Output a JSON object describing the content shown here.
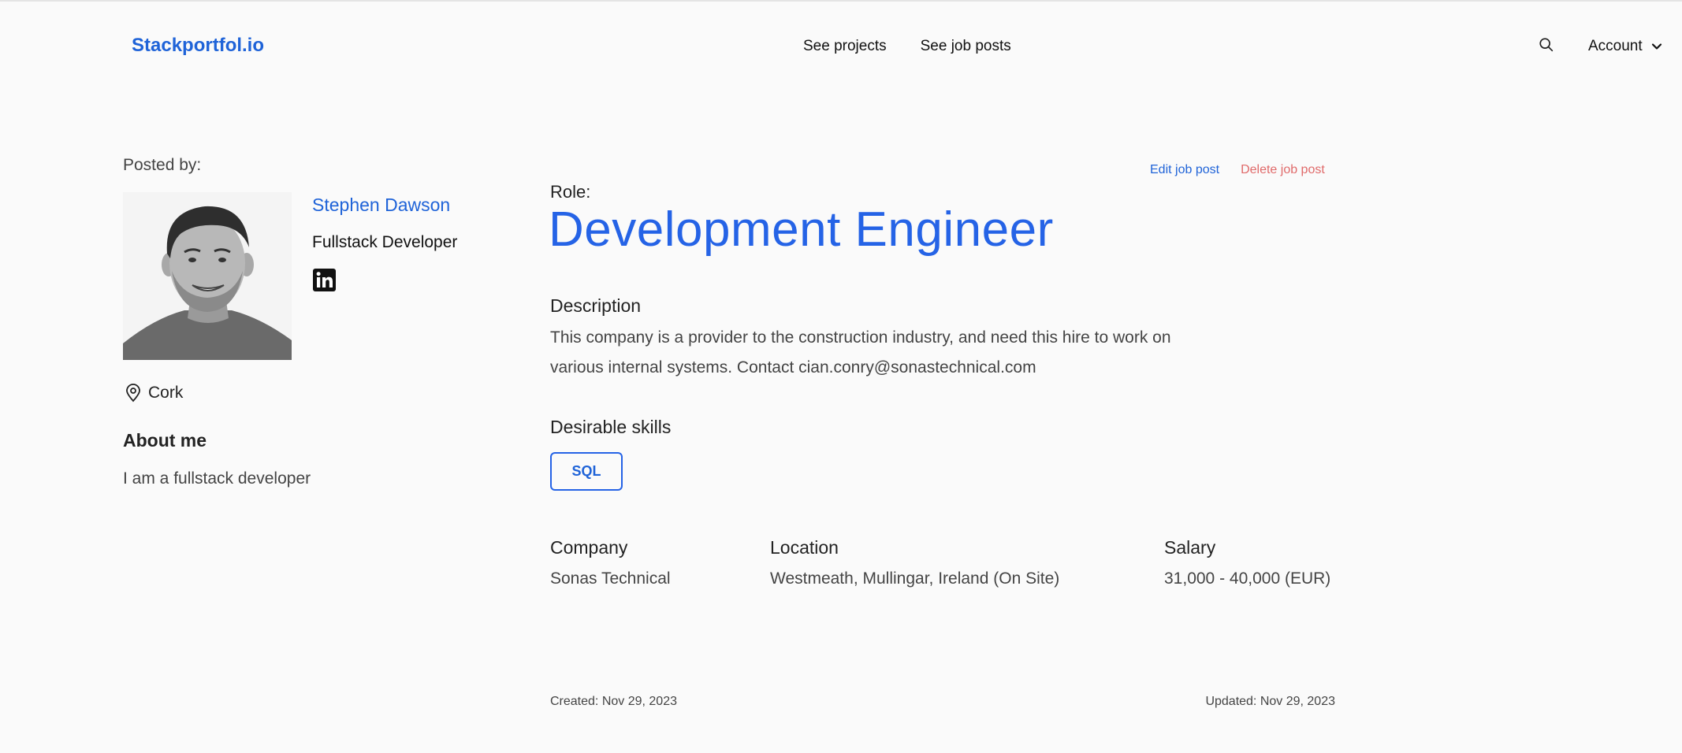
{
  "header": {
    "brand": "Stackportfol.io",
    "nav": [
      "See projects",
      "See job posts"
    ],
    "search_icon": "search-icon",
    "account_label": "Account",
    "account_icon": "chevron-down-icon"
  },
  "sidebar": {
    "posted_by_label": "Posted by:",
    "author": {
      "name": "Stephen Dawson",
      "title": "Fullstack Developer",
      "social_icon": "linkedin-icon",
      "location_icon": "map-pin-icon",
      "location": "Cork"
    },
    "about_heading": "About me",
    "about_text": "I am a fullstack developer"
  },
  "job": {
    "actions": {
      "edit": "Edit job post",
      "delete": "Delete job post"
    },
    "role_label": "Role:",
    "role": "Development Engineer",
    "description_heading": "Description",
    "description": "This company is a provider to the construction industry, and need this hire to work on various internal systems. Contact cian.conry@sonastechnical.com",
    "skills_heading": "Desirable skills",
    "skills": [
      "SQL"
    ],
    "details": {
      "company_label": "Company",
      "company": "Sonas Technical",
      "location_label": "Location",
      "location": "Westmeath, Mullingar, Ireland (On Site)",
      "salary_label": "Salary",
      "salary": "31,000 - 40,000 (EUR)"
    },
    "created": "Created: Nov 29, 2023",
    "updated": "Updated: Nov 29, 2023"
  },
  "colors": {
    "accent": "#2563e6",
    "brand": "#1f63d8",
    "danger": "#e06a6a",
    "background": "#fafafa"
  }
}
